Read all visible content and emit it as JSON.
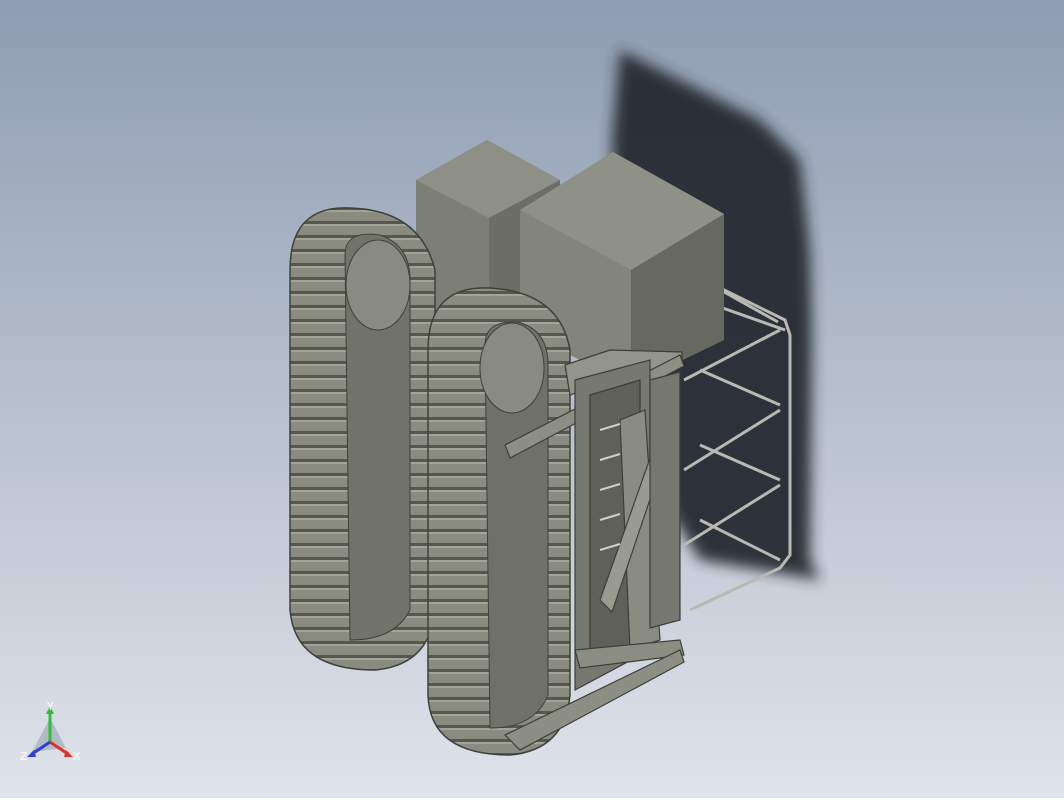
{
  "viewport": {
    "background_top": "#8e9db2",
    "background_bottom": "#dfe3ea",
    "shadow_color": "#272a2f",
    "body_light": "#8f8f84",
    "body_mid": "#7b7c72",
    "body_dark": "#65665d"
  },
  "triad": {
    "x_label": "X",
    "y_label": "Y",
    "z_label": "Z",
    "x_color": "#e03030",
    "y_color": "#2fbf3a",
    "z_color": "#2d3fd6"
  }
}
